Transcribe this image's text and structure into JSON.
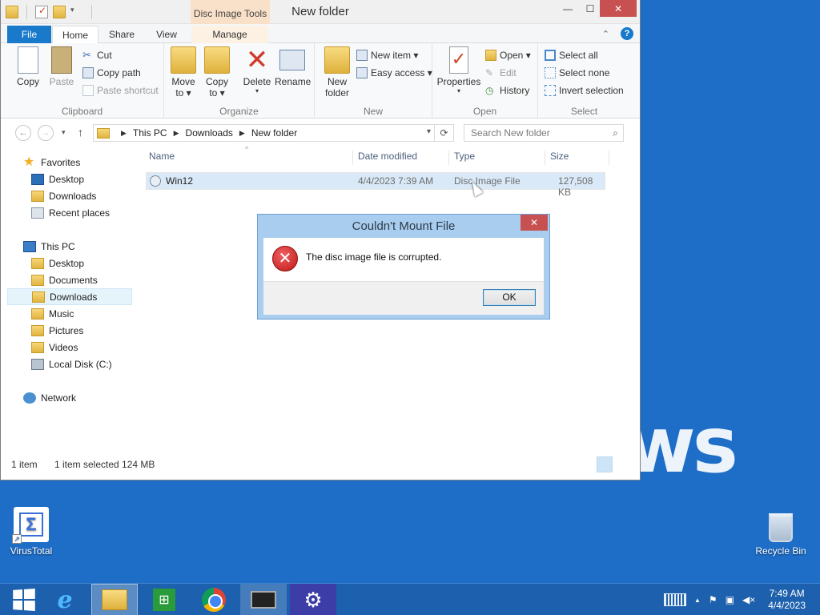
{
  "window": {
    "title": "New folder",
    "context_tab_title": "Disc Image Tools",
    "controls": {
      "minimize": "—",
      "maximize": "☐",
      "close": "✕"
    }
  },
  "tabs": {
    "file": "File",
    "home": "Home",
    "share": "Share",
    "view": "View",
    "manage": "Manage"
  },
  "ribbon": {
    "clipboard": {
      "label": "Clipboard",
      "copy": "Copy",
      "paste": "Paste",
      "cut": "Cut",
      "copy_path": "Copy path",
      "paste_shortcut": "Paste shortcut"
    },
    "organize": {
      "label": "Organize",
      "move_to": "Move",
      "move_to_2": "to ▾",
      "copy_to": "Copy",
      "copy_to_2": "to ▾",
      "delete": "Delete",
      "delete_2": "▾",
      "rename": "Rename"
    },
    "new": {
      "label": "New",
      "new_folder": "New",
      "new_folder_2": "folder",
      "new_item": "New item ▾",
      "easy_access": "Easy access ▾"
    },
    "open": {
      "label": "Open",
      "properties": "Properties",
      "properties_2": "▾",
      "open": "Open ▾",
      "edit": "Edit",
      "history": "History"
    },
    "select": {
      "label": "Select",
      "select_all": "Select all",
      "select_none": "Select none",
      "invert": "Invert selection"
    }
  },
  "address": {
    "back": "←",
    "forward": "→",
    "recent": "▾",
    "up": "↑",
    "segments": [
      "This PC",
      "Downloads",
      "New folder"
    ],
    "separator": "▶",
    "dropdown": "▾",
    "refresh": "⟳",
    "search_placeholder": "Search New folder",
    "search_icon": "⌕"
  },
  "nav": {
    "favorites": "Favorites",
    "fav_desktop": "Desktop",
    "fav_downloads": "Downloads",
    "fav_recent": "Recent places",
    "this_pc": "This PC",
    "pc_desktop": "Desktop",
    "pc_documents": "Documents",
    "pc_downloads": "Downloads",
    "pc_music": "Music",
    "pc_pictures": "Pictures",
    "pc_videos": "Videos",
    "pc_disk": "Local Disk (C:)",
    "network": "Network"
  },
  "filelist": {
    "columns": {
      "name": "Name",
      "date": "Date modified",
      "type": "Type",
      "size": "Size"
    },
    "sort_indicator": "^",
    "rows": [
      {
        "name": "Win12",
        "date": "4/4/2023 7:39 AM",
        "type": "Disc Image File",
        "size": "127,508 KB"
      }
    ]
  },
  "status": {
    "count": "1 item",
    "selected": "1 item selected  124 MB"
  },
  "dialog": {
    "title": "Couldn't Mount File",
    "message": "The disc image file is corrupted.",
    "ok": "OK",
    "close": "✕",
    "error_glyph": "✕"
  },
  "desktop": {
    "virustotal": "VirusTotal",
    "virustotal_glyph": "Σ",
    "shortcut_glyph": "↗",
    "recycle_bin": "Recycle Bin",
    "wallpaper_text": "ws"
  },
  "taskbar": {
    "ie_glyph": "e",
    "store_glyph": "⊞",
    "settings_glyph": "⚙",
    "tray_up": "▲",
    "tray_flag": "⚑",
    "tray_network": "▣",
    "tray_volume": "◀×",
    "time": "7:49 AM",
    "date": "4/4/2023"
  },
  "colors": {
    "desktop": "#1e6ec8",
    "taskbar": "#1d60ad",
    "file_tab": "#1979ca",
    "dialog_frame": "#a9cdee",
    "close_red": "#c75050"
  }
}
